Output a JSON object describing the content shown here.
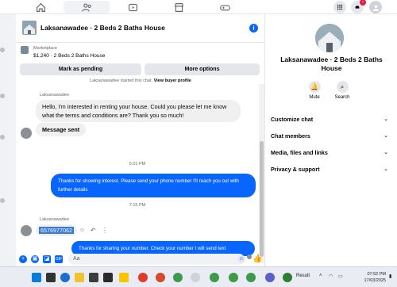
{
  "conversation": {
    "title": "Laksanawadee · 2 Beds 2 Baths House",
    "marketplace_label": "Marketplace",
    "listing": "$1,240 · 2 Beds 2 Baths House",
    "mark_pending": "Mark as pending",
    "more_options": "More options",
    "started_text": "Laksanawadee started this chat.",
    "view_profile": "View buyer profile"
  },
  "messages": {
    "sender1": "Laksanawadee",
    "msg1": "Hello, I'm interested in renting your house. Could you please let me know what the terms and conditions are? Thank you so much!",
    "msg2": "Message sent",
    "time1": "6:01 PM",
    "msg3": "Thanks for showing interest. Please send your phone number  I'll reach you out with further details",
    "time2": "7:15 PM",
    "sender2": "Laksanawadee",
    "msg4": "6576977062",
    "msg5": "Thanks for sharing your number.  Check your number I will send text"
  },
  "composer": {
    "placeholder": "Aa"
  },
  "right_panel": {
    "title": "Laksanawadee · 2 Beds 2 Baths House",
    "mute": "Mute",
    "search": "Search",
    "sections": [
      "Customize chat",
      "Chat members",
      "Media, files and links",
      "Privacy & support"
    ]
  },
  "taskbar": {
    "result_label": "Result",
    "time": "07:52 PM",
    "date": "17/03/2025"
  },
  "colors": {
    "accent": "#0866ff",
    "bubble_in": "#f0f0f0"
  }
}
